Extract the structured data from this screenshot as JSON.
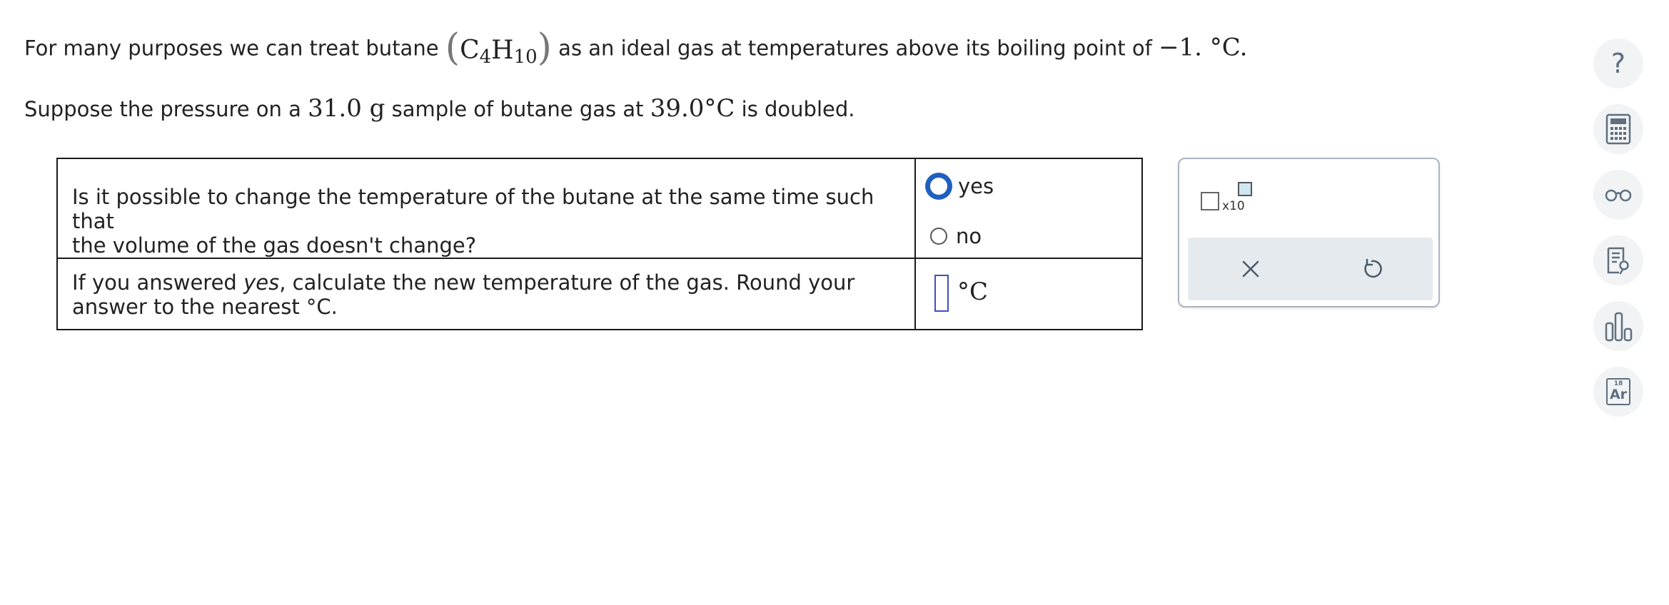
{
  "intro": {
    "before": "For many purposes we can treat butane ",
    "formula_open": "(",
    "formula_c": "C",
    "formula_c_sub": "4",
    "formula_h": "H",
    "formula_h_sub": "10",
    "formula_close": ")",
    "after": " as an ideal gas at temperatures above its boiling point of ",
    "boiling_point": "−1. °C."
  },
  "setup": {
    "before": "Suppose the pressure on a ",
    "mass": "31.0 g",
    "middle": " sample of butane gas at ",
    "temperature": "39.0°C",
    "after": " is doubled."
  },
  "question1": {
    "text_line1": "Is it possible to change the temperature of the butane at the same time such that",
    "text_line2": "the volume of the gas doesn't change?",
    "option_yes": "yes",
    "option_no": "no"
  },
  "question2": {
    "text_before": "If you answered ",
    "text_emph": "yes",
    "text_after": ", calculate the new temperature of the gas. Round your",
    "text_line2": "answer to the nearest °C.",
    "answer_value": "",
    "unit": "°C"
  },
  "tools_panel": {
    "sci_label": "x10"
  },
  "sidebar": {
    "help": "?",
    "periodic_number": "18",
    "periodic_symbol": "Ar"
  },
  "colors": {
    "focus_blue": "#1f5fbf",
    "input_border": "#3f4fbf",
    "icon_gray": "#5f6f7f",
    "tools_bar": "#e5eaee"
  }
}
